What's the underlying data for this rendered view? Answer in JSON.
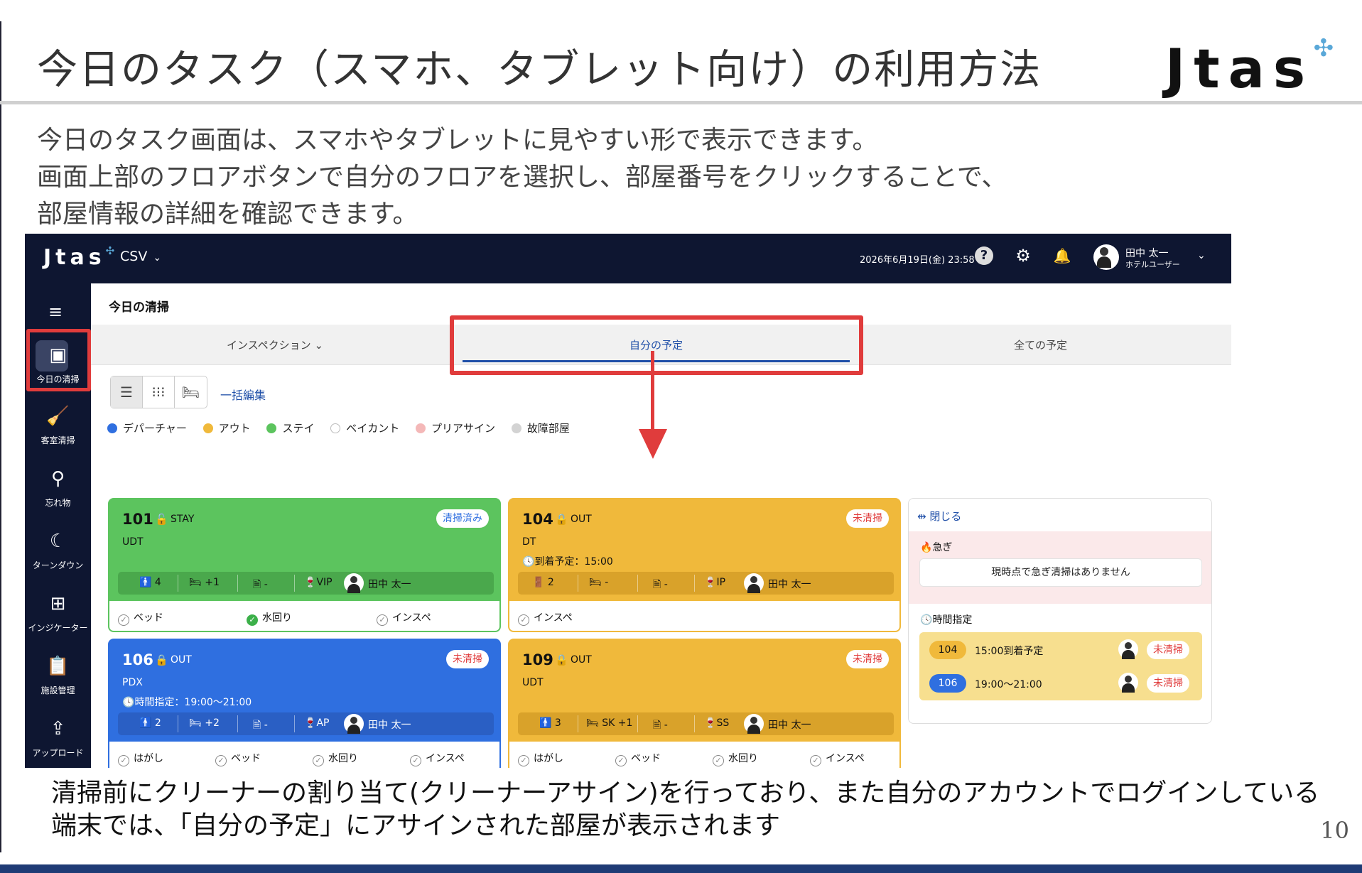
{
  "slide": {
    "title": "今日のタスク（スマホ、タブレット向け）の利用方法",
    "brand": "Jtas",
    "intro": [
      "今日のタスク画面は、スマホやタブレットに見やすい形で表示できます。",
      "画面上部のフロアボタンで自分のフロアを選択し、部屋番号をクリックすることで、",
      "部屋情報の詳細を確認できます。"
    ],
    "outro": [
      "清掃前にクリーナーの割り当て(クリーナーアサイン)を行っており、また自分のアカウントでログインしている",
      "端末では、「自分の予定」にアサインされた部屋が表示されます"
    ],
    "page_number": "10",
    "accent_color": "#e03c3c"
  },
  "app": {
    "brand": "Jtas",
    "csv_label": "CSV",
    "datetime": "2026年6月19日(金) 23:58",
    "user": {
      "name": "田中 太一",
      "role": "ホテルユーザー"
    },
    "sidebar": [
      {
        "label": "今日の清掃",
        "icon": "calendar-icon"
      },
      {
        "label": "客室清掃",
        "icon": "broom-icon"
      },
      {
        "label": "忘れ物",
        "icon": "search-icon"
      },
      {
        "label": "ターンダウン",
        "icon": "moon-icon"
      },
      {
        "label": "インジケーター",
        "icon": "grid-icon"
      },
      {
        "label": "施設管理",
        "icon": "clipboard-icon"
      },
      {
        "label": "アップロード",
        "icon": "upload-icon"
      }
    ],
    "page_heading": "今日の清掃",
    "tabs": [
      "インスペクション",
      "自分の予定",
      "全ての予定"
    ],
    "bulk_edit": "一括編集",
    "legend": [
      {
        "label": "デパーチャー",
        "color": "#2f6fe0"
      },
      {
        "label": "アウト",
        "color": "#f0b93b"
      },
      {
        "label": "ステイ",
        "color": "#5cc45e"
      },
      {
        "label": "ベイカント",
        "color": "#ffffff"
      },
      {
        "label": "プリアサイン",
        "color": "#f4b8b8"
      },
      {
        "label": "故障部屋",
        "color": "#d3d3d3"
      }
    ],
    "cards": [
      {
        "room": "101",
        "status": "STAY",
        "type": "UDT",
        "note": "",
        "badge": "清掃済み",
        "info": {
          "guests": "4",
          "beds": "+1",
          "doc": "-",
          "tag": "VIP",
          "cleaner": "田中 太一"
        },
        "checks": [
          "ベッド",
          "水回り",
          "インスペ"
        ]
      },
      {
        "room": "104",
        "status": "OUT",
        "type": "DT",
        "note": "到着予定：15:00",
        "badge": "未清掃",
        "info": {
          "guests": "2",
          "beds": "-",
          "doc": "-",
          "tag": "IP",
          "cleaner": "田中 太一"
        },
        "checks": [
          "インスペ"
        ]
      },
      {
        "room": "106",
        "status": "OUT",
        "type": "PDX",
        "note": "時間指定：19:00〜21:00",
        "badge": "未清掃",
        "info": {
          "guests": "2",
          "beds": "+2",
          "doc": "-",
          "tag": "AP",
          "cleaner": "田中 太一"
        },
        "checks": [
          "はがし",
          "ベッド",
          "水回り",
          "インスペ"
        ]
      },
      {
        "room": "109",
        "status": "OUT",
        "type": "UDT",
        "note": "",
        "badge": "未清掃",
        "info": {
          "guests": "3",
          "beds": "SK +1",
          "doc": "-",
          "tag": "SS",
          "cleaner": "田中 太一"
        },
        "checks": [
          "はがし",
          "ベッド",
          "水回り",
          "インスペ"
        ]
      }
    ],
    "panel": {
      "close": "閉じる",
      "urgent_title": "急ぎ",
      "urgent_message": "現時点で急ぎ清掃はありません",
      "timed_title": "時間指定",
      "timed": [
        {
          "room": "104",
          "text": "15:00到着予定",
          "badge": "未清掃"
        },
        {
          "room": "106",
          "text": "19:00〜21:00",
          "badge": "未清掃"
        }
      ]
    }
  }
}
